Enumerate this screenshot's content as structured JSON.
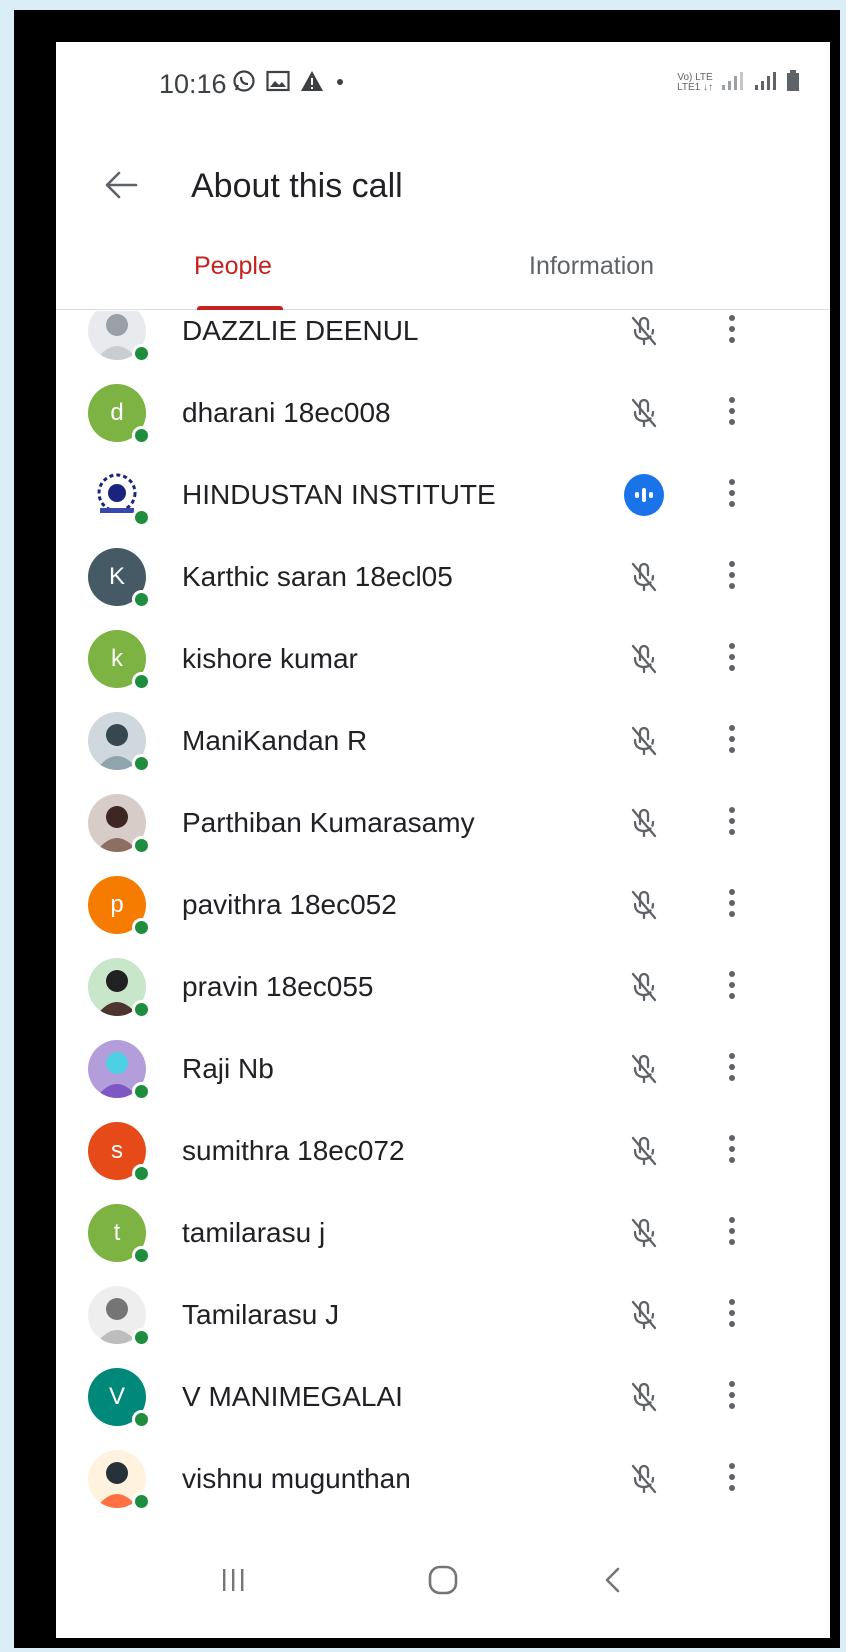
{
  "status_bar": {
    "time": "10:16",
    "icons_left": [
      "whatsapp-icon",
      "gallery-icon",
      "warning-icon",
      "dot-icon"
    ],
    "network_top": "Vo) LTE",
    "network_bottom": "LTE1 ↓↑",
    "icons_right": [
      "signal-icon",
      "signal-icon",
      "battery-icon"
    ]
  },
  "header": {
    "back_icon": "arrow-left-icon",
    "title": "About this call"
  },
  "tabs": [
    {
      "label": "People",
      "active": true
    },
    {
      "label": "Information",
      "active": false
    }
  ],
  "participants": [
    {
      "name": "DAZZLIE DEENUL",
      "avatar": {
        "type": "photo",
        "letter": ""
      },
      "mic": "muted"
    },
    {
      "name": "dharani 18ec008",
      "avatar": {
        "type": "letter",
        "letter": "d",
        "color": "#7cb342"
      },
      "mic": "muted"
    },
    {
      "name": "HINDUSTAN INSTITUTE",
      "avatar": {
        "type": "logo",
        "letter": ""
      },
      "mic": "speaking"
    },
    {
      "name": "Karthic saran 18ecl05",
      "avatar": {
        "type": "letter",
        "letter": "K",
        "color": "#455a64"
      },
      "mic": "muted"
    },
    {
      "name": "kishore kumar",
      "avatar": {
        "type": "letter",
        "letter": "k",
        "color": "#7cb342"
      },
      "mic": "muted"
    },
    {
      "name": "ManiKandan R",
      "avatar": {
        "type": "photo",
        "letter": ""
      },
      "mic": "muted"
    },
    {
      "name": "Parthiban Kumarasamy",
      "avatar": {
        "type": "photo",
        "letter": ""
      },
      "mic": "muted"
    },
    {
      "name": "pavithra 18ec052",
      "avatar": {
        "type": "letter",
        "letter": "p",
        "color": "#f57c00"
      },
      "mic": "muted"
    },
    {
      "name": "pravin 18ec055",
      "avatar": {
        "type": "photo",
        "letter": ""
      },
      "mic": "muted"
    },
    {
      "name": "Raji Nb",
      "avatar": {
        "type": "photo",
        "letter": ""
      },
      "mic": "muted"
    },
    {
      "name": "sumithra 18ec072",
      "avatar": {
        "type": "letter",
        "letter": "s",
        "color": "#e64a19"
      },
      "mic": "muted"
    },
    {
      "name": "tamilarasu j",
      "avatar": {
        "type": "letter",
        "letter": "t",
        "color": "#7cb342"
      },
      "mic": "muted"
    },
    {
      "name": "Tamilarasu J",
      "avatar": {
        "type": "photo",
        "letter": ""
      },
      "mic": "muted"
    },
    {
      "name": "V MANIMEGALAI",
      "avatar": {
        "type": "letter",
        "letter": "V",
        "color": "#00897b"
      },
      "mic": "muted"
    },
    {
      "name": "vishnu mugunthan",
      "avatar": {
        "type": "photo",
        "letter": ""
      },
      "mic": "muted"
    }
  ],
  "colors": {
    "accent": "#c5221f",
    "presence": "#1e8e3e",
    "speaking": "#1a73e8"
  },
  "nav_bar": [
    "recents-icon",
    "home-icon",
    "back-icon"
  ]
}
